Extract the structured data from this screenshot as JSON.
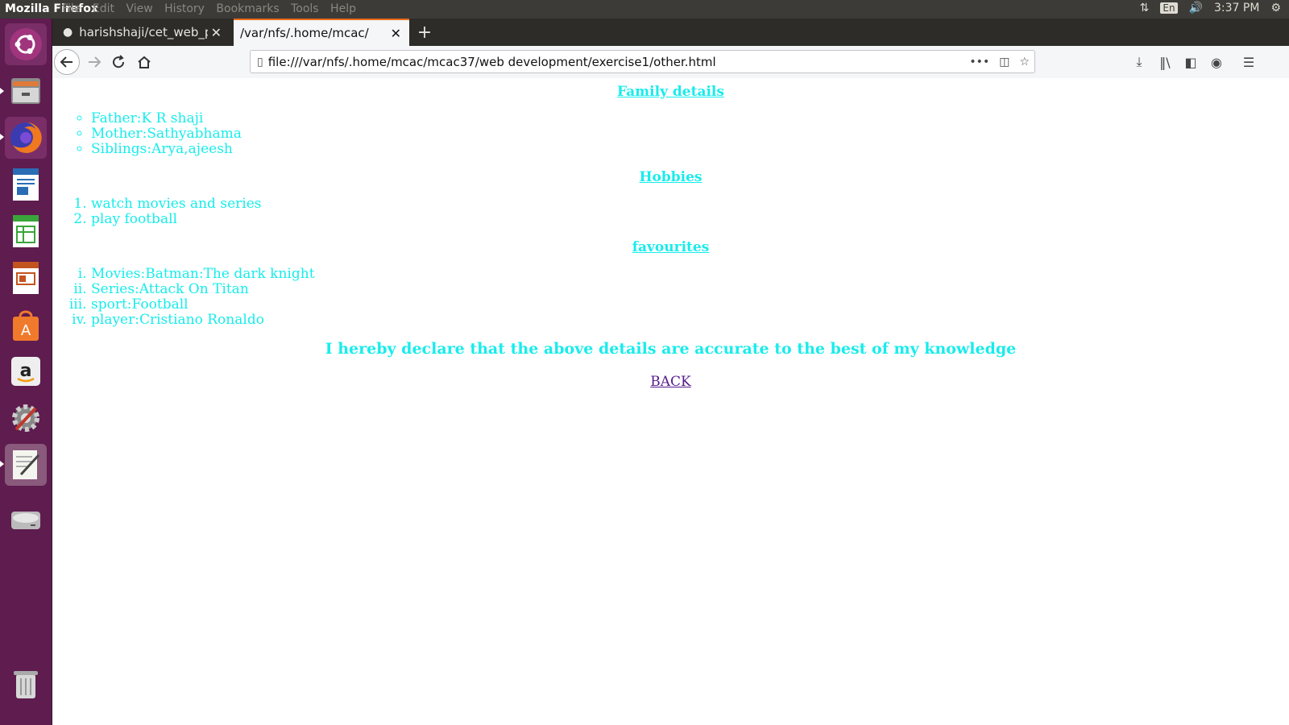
{
  "system": {
    "app_title": "Mozilla Firefox",
    "menu": [
      "File",
      "Edit",
      "View",
      "History",
      "Bookmarks",
      "Tools",
      "Help"
    ],
    "keyboard_layout": "En",
    "clock": "3:37 PM"
  },
  "browser": {
    "tabs": [
      {
        "label": "harishshaji/cet_web_pr",
        "active": false
      },
      {
        "label": "/var/nfs/.home/mcac/mcac",
        "active": true
      }
    ],
    "url": "file:///var/nfs/.home/mcac/mcac37/web development/exercise1/other.html",
    "accent_color": "#e66b1a"
  },
  "launcher": {
    "items": [
      "ubuntu-dash-icon",
      "files-icon",
      "firefox-icon",
      "writer-icon",
      "calc-icon",
      "impress-icon",
      "software-center-icon",
      "amazon-icon",
      "system-settings-icon",
      "text-editor-icon",
      "disk-icon",
      "trash-icon"
    ]
  },
  "page": {
    "text_color": "#18ecec",
    "link_color": "#551a8b",
    "family": {
      "title": "Family details",
      "items": [
        "Father:K R shaji",
        "Mother:Sathyabhama",
        "Siblings:Arya,ajeesh"
      ]
    },
    "hobbies": {
      "title": "Hobbies",
      "items": [
        "watch movies and series",
        "play football"
      ]
    },
    "favourites": {
      "title": "favourites",
      "items": [
        "Movies:Batman:The dark knight",
        "Series:Attack On Titan",
        "sport:Football",
        "player:Cristiano Ronaldo"
      ]
    },
    "declaration": "I hereby declare that the above details are accurate to the best of my knowledge",
    "back_link": "BACK"
  }
}
